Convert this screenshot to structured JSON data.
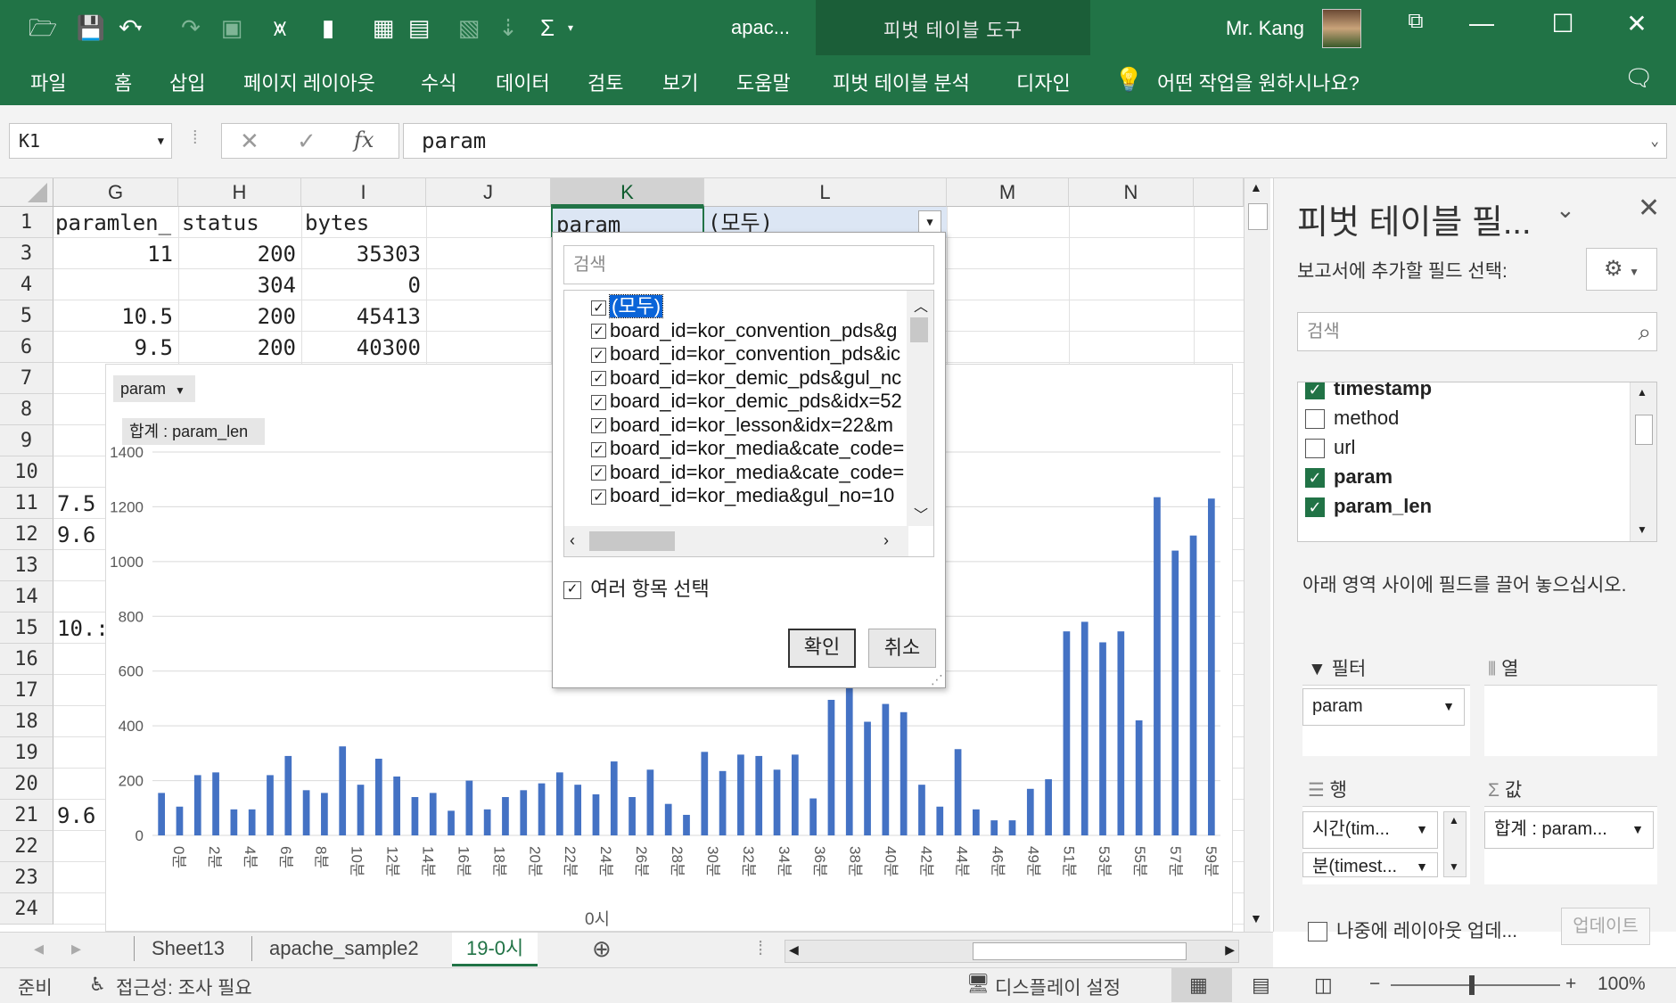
{
  "titlebar": {
    "doc_title": "apac...",
    "context_tool": "피벗 테이블 도구",
    "user": "Mr. Kang"
  },
  "ribbon": {
    "tabs": [
      "파일",
      "홈",
      "삽입",
      "페이지 레이아웃",
      "수식",
      "데이터",
      "검토",
      "보기",
      "도움말",
      "피벗 테이블 분석",
      "디자인"
    ],
    "tell_me": "어떤 작업을 원하시나요?"
  },
  "formula": {
    "name_box": "K1",
    "fx": "fx",
    "content": "param"
  },
  "grid": {
    "columns": [
      "G",
      "H",
      "I",
      "J",
      "K",
      "L",
      "M",
      "N"
    ],
    "rows": [
      "1",
      "3",
      "4",
      "5",
      "6",
      "7",
      "8",
      "9",
      "10",
      "11",
      "12",
      "13",
      "14",
      "15",
      "16",
      "17",
      "18",
      "19",
      "20",
      "21",
      "22",
      "23",
      "24"
    ],
    "cells": {
      "g1": "paramlen_",
      "h1": "status",
      "i1": "bytes",
      "k1": "param",
      "l1": "(모두)",
      "g3": "11",
      "h3": "200",
      "i3": "35303",
      "h4": "304",
      "i4": "0",
      "g5": "10.5",
      "h5": "200",
      "i5": "45413",
      "g6": "9.5",
      "h6": "200",
      "i6": "40300",
      "g11": "7.5",
      "g12": "9.6",
      "g15": "10.:",
      "g21": "9.6"
    }
  },
  "chart": {
    "filter_button": "param",
    "value_button": "합계 : param_len",
    "x_axis_title": "0시"
  },
  "chart_data": {
    "type": "bar",
    "ylim": [
      0,
      1400
    ],
    "yticks": [
      0,
      200,
      400,
      600,
      800,
      1000,
      1200,
      1400
    ],
    "xticks": [
      "0분",
      "2분",
      "4분",
      "6분",
      "8분",
      "10분",
      "12분",
      "14분",
      "16분",
      "18분",
      "20분",
      "22분",
      "24분",
      "26분",
      "28분",
      "30분",
      "32분",
      "34분",
      "36분",
      "38분",
      "40분",
      "42분",
      "44분",
      "46분",
      "49분",
      "51분",
      "53분",
      "55분",
      "57분",
      "59분"
    ],
    "values": [
      155,
      105,
      220,
      230,
      95,
      95,
      220,
      290,
      165,
      155,
      325,
      185,
      280,
      215,
      140,
      155,
      90,
      200,
      95,
      140,
      165,
      190,
      230,
      185,
      150,
      270,
      140,
      240,
      115,
      75,
      305,
      235,
      295,
      290,
      240,
      295,
      135,
      495,
      590,
      415,
      480,
      450,
      185,
      105,
      315,
      95,
      55,
      55,
      170,
      205,
      745,
      780,
      705,
      745,
      420,
      1235,
      1040,
      1095,
      1230
    ]
  },
  "dropdown": {
    "search_placeholder": "검색",
    "items": [
      {
        "label": "(모두)",
        "checked": true
      },
      {
        "label": "board_id=kor_convention_pds&g",
        "checked": true
      },
      {
        "label": "board_id=kor_convention_pds&ic",
        "checked": true
      },
      {
        "label": "board_id=kor_demic_pds&gul_nc",
        "checked": true
      },
      {
        "label": "board_id=kor_demic_pds&idx=52",
        "checked": true
      },
      {
        "label": "board_id=kor_lesson&idx=22&m",
        "checked": true
      },
      {
        "label": "board_id=kor_media&cate_code=",
        "checked": true
      },
      {
        "label": "board_id=kor_media&cate_code=",
        "checked": true
      },
      {
        "label": "board_id=kor_media&gul_no=10",
        "checked": true
      }
    ],
    "multi_select": "여러 항목 선택",
    "ok": "확인",
    "cancel": "취소"
  },
  "pane": {
    "title": "피벗 테이블 필...",
    "subtitle": "보고서에 추가할 필드 선택:",
    "search_placeholder": "검색",
    "fields": [
      {
        "name": "timestamp",
        "checked": true
      },
      {
        "name": "method",
        "checked": false
      },
      {
        "name": "url",
        "checked": false
      },
      {
        "name": "param",
        "checked": true
      },
      {
        "name": "param_len",
        "checked": true
      }
    ],
    "hint": "아래 영역 사이에 필드를 끌어 놓으십시오.",
    "areas": {
      "filter_label": "필터",
      "columns_label": "열",
      "rows_label": "행",
      "values_label": "값",
      "filter_item": "param",
      "row_item_1": "시간(tim...",
      "row_item_2": "분(timest...",
      "value_item": "합계 : param..."
    },
    "defer": "나중에 레이아웃 업데...",
    "update": "업데이트"
  },
  "sheets": {
    "tabs": [
      "Sheet13",
      "apache_sample2",
      "19-0시"
    ],
    "active": "19-0시"
  },
  "status": {
    "ready": "준비",
    "accessibility": "접근성: 조사 필요",
    "display": "디스플레이 설정",
    "zoom": "100%"
  }
}
